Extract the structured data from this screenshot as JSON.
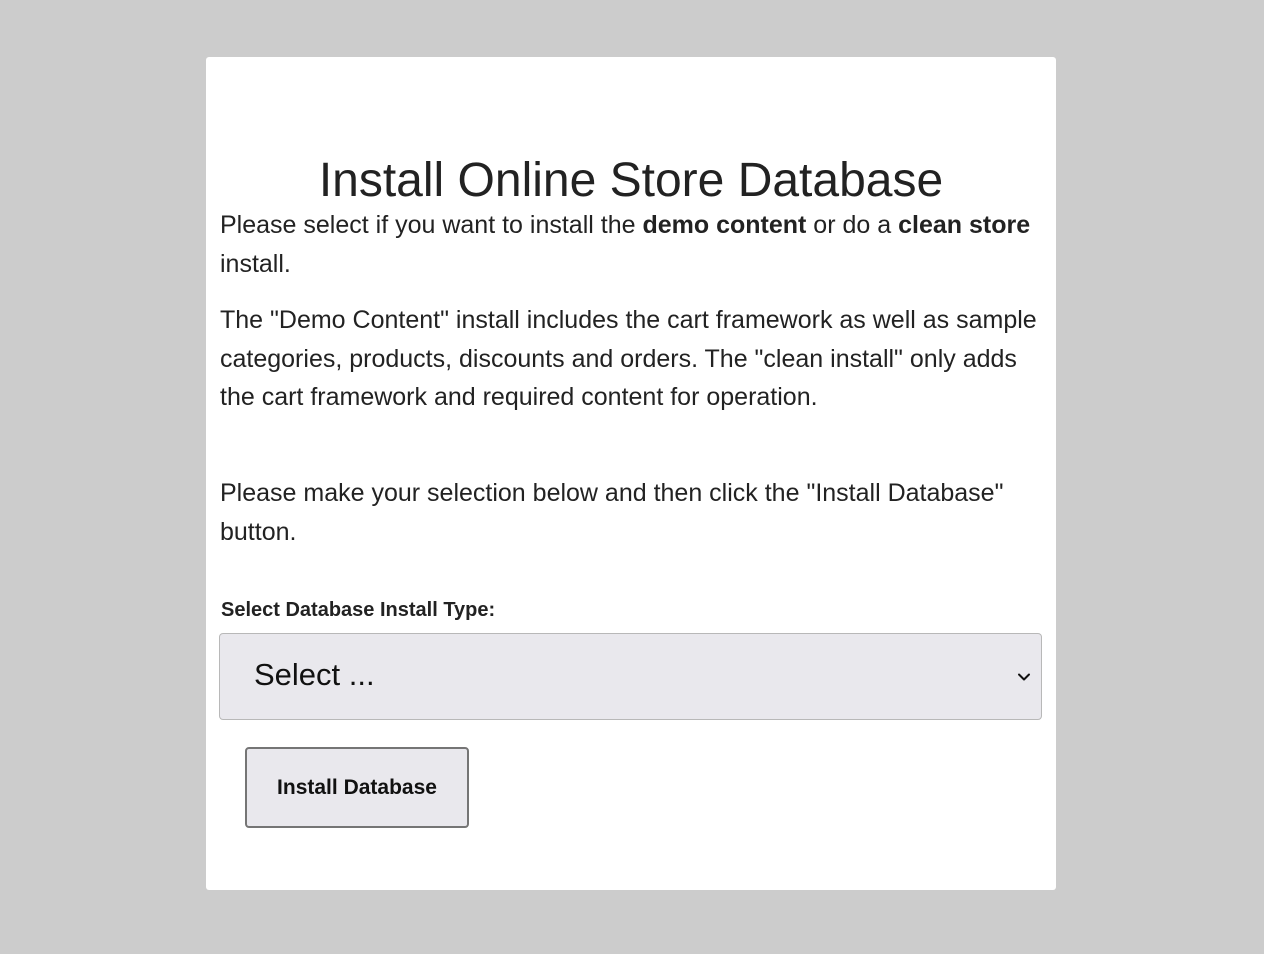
{
  "page": {
    "title": "Install Online Store Database"
  },
  "intro": {
    "part1": "Please select if you want to install the ",
    "bold1": "demo content",
    "part2": " or do a ",
    "bold2": "clean store",
    "part3": " install."
  },
  "description": "The \"Demo Content\" install includes the cart framework as well as sample categories, products, discounts and orders. The \"clean install\" only adds the cart framework and required content for operation.",
  "instruction": "Please make your selection below and then click the \"Install Database\" button.",
  "form": {
    "select_label": "Select Database Install Type:",
    "select_value": "Select ...",
    "install_button_label": "Install Database"
  },
  "icons": {
    "select_arrow": "chevron-down-icon"
  },
  "colors": {
    "background": "#cccccc",
    "card": "#ffffff",
    "control": "#e9e8ed",
    "text": "#222222"
  }
}
